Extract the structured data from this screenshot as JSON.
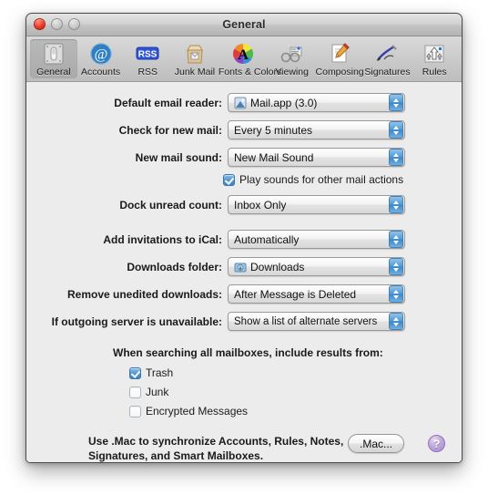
{
  "window": {
    "title": "General",
    "traffic_lights": [
      "close",
      "minimize",
      "zoom"
    ]
  },
  "toolbar": {
    "items": [
      {
        "label": "General",
        "icon": "general-switch-icon",
        "selected": true
      },
      {
        "label": "Accounts",
        "icon": "at-sign-icon",
        "selected": false
      },
      {
        "label": "RSS",
        "icon": "rss-badge-icon",
        "selected": false
      },
      {
        "label": "Junk Mail",
        "icon": "junk-mail-bag-icon",
        "selected": false
      },
      {
        "label": "Fonts & Colors",
        "icon": "color-wheel-a-icon",
        "selected": false
      },
      {
        "label": "Viewing",
        "icon": "viewing-glasses-icon",
        "selected": false
      },
      {
        "label": "Composing",
        "icon": "composing-pencil-icon",
        "selected": false
      },
      {
        "label": "Signatures",
        "icon": "signature-pen-icon",
        "selected": false
      },
      {
        "label": "Rules",
        "icon": "rules-arrows-icon",
        "selected": false
      }
    ]
  },
  "form": {
    "default_email_reader": {
      "label": "Default email reader:",
      "value": "Mail.app (3.0)",
      "icon": "mail-app-stamp-icon"
    },
    "check_for_new_mail": {
      "label": "Check for new mail:",
      "value": "Every 5 minutes"
    },
    "new_mail_sound": {
      "label": "New mail sound:",
      "value": "New Mail Sound"
    },
    "play_sounds": {
      "label": "Play sounds for other mail actions",
      "checked": true
    },
    "dock_unread_count": {
      "label": "Dock unread count:",
      "value": "Inbox Only"
    },
    "add_invitations": {
      "label": "Add invitations to iCal:",
      "value": "Automatically"
    },
    "downloads_folder": {
      "label": "Downloads folder:",
      "value": "Downloads",
      "icon": "downloads-folder-icon"
    },
    "remove_unedited": {
      "label": "Remove unedited downloads:",
      "value": "After Message is Deleted"
    },
    "outgoing_server": {
      "label": "If outgoing server is unavailable:",
      "value": "Show a list of alternate servers"
    }
  },
  "search_section": {
    "heading": "When searching all mailboxes, include results from:",
    "options": [
      {
        "label": "Trash",
        "checked": true
      },
      {
        "label": "Junk",
        "checked": false
      },
      {
        "label": "Encrypted Messages",
        "checked": false
      }
    ]
  },
  "footer": {
    "line1": "Use .Mac to synchronize Accounts, Rules, Notes,",
    "line2": "Signatures, and Smart Mailboxes.",
    "mac_button": ".Mac...",
    "help_button": "?"
  },
  "colors": {
    "accent_blue": "#4f97d4",
    "window_bg": "#ececec",
    "help_purple": "#a98cd0"
  }
}
